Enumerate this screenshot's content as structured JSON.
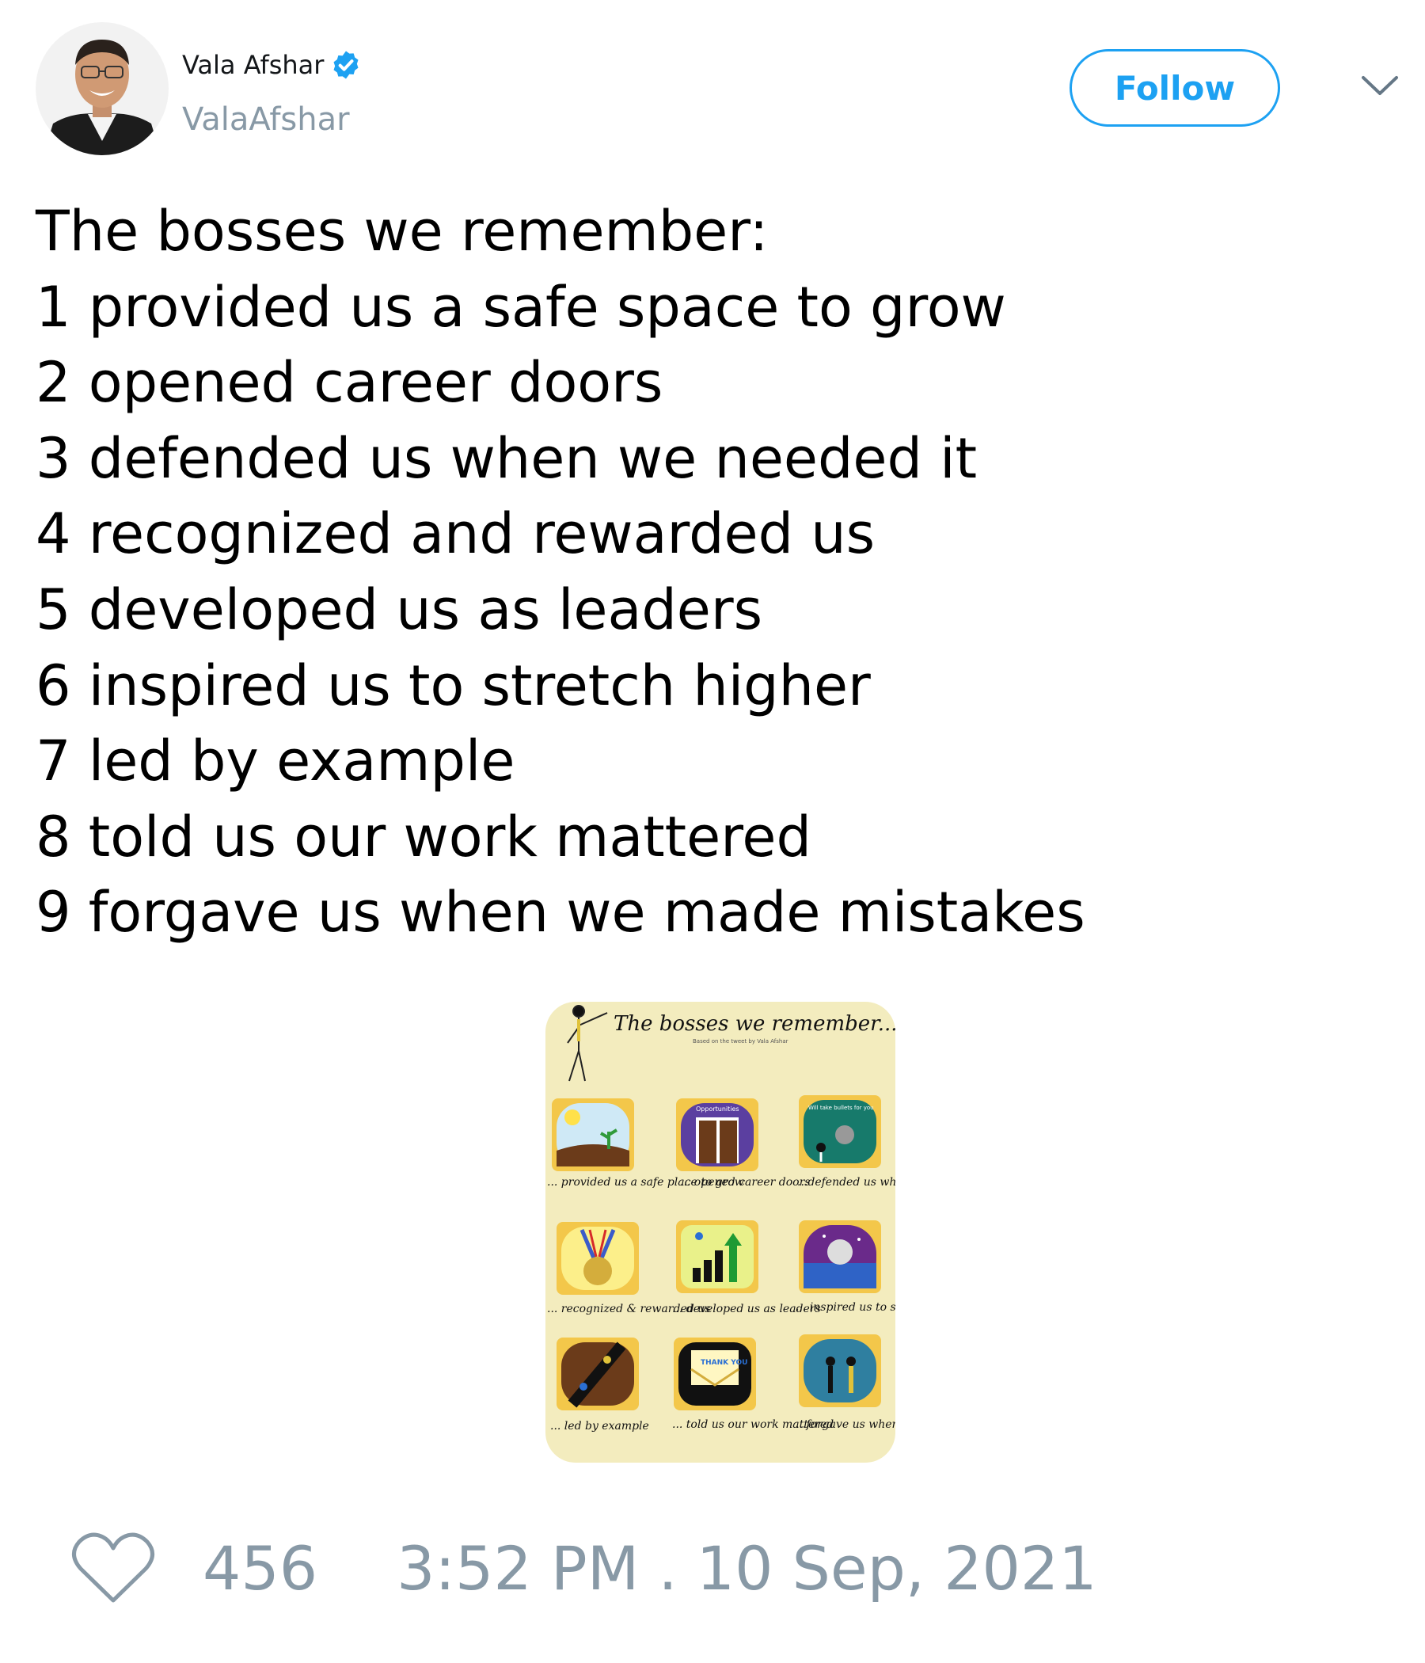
{
  "author": {
    "name": "Vala Afshar",
    "handle": "ValaAfshar",
    "verified_icon": "verified-badge-icon"
  },
  "follow_label": "Follow",
  "menu_icon": "chevron-down-icon",
  "tweet": {
    "lines": [
      "The bosses we remember:",
      "1 provided us a safe space to grow",
      "2 opened career doors",
      "3 defended us when we needed it",
      "4 recognized and rewarded us",
      "5 developed us as leaders",
      "6 inspired us to stretch higher",
      "7 led by example",
      "8 told us our work mattered",
      "9 forgave us when we made mistakes"
    ]
  },
  "media": {
    "title": "The bosses we remember...",
    "subtitle": "Based on the tweet by Vala Afshar",
    "captions": [
      "... provided us a safe place to grow",
      "... opened career doors",
      "...defended us when we needed it",
      "... recognized & rewarded us",
      "... developed us as leaders",
      "... inspired us to stretch higher",
      "... led by example",
      "... told us our work mattered",
      "...forgave us when we made mistakes"
    ],
    "tile_labels": [
      "Opportunities",
      "Will take bullets for you",
      "THANK YOU"
    ]
  },
  "footer": {
    "likes": "456",
    "timestamp": "3:52 PM . 10 Sep, 2021",
    "like_icon": "heart-icon"
  },
  "colors": {
    "accent": "#1da1f2",
    "muted": "#8899a6",
    "poster_bg": "#f3ecbe",
    "tile_frame": "#f3c74a"
  }
}
